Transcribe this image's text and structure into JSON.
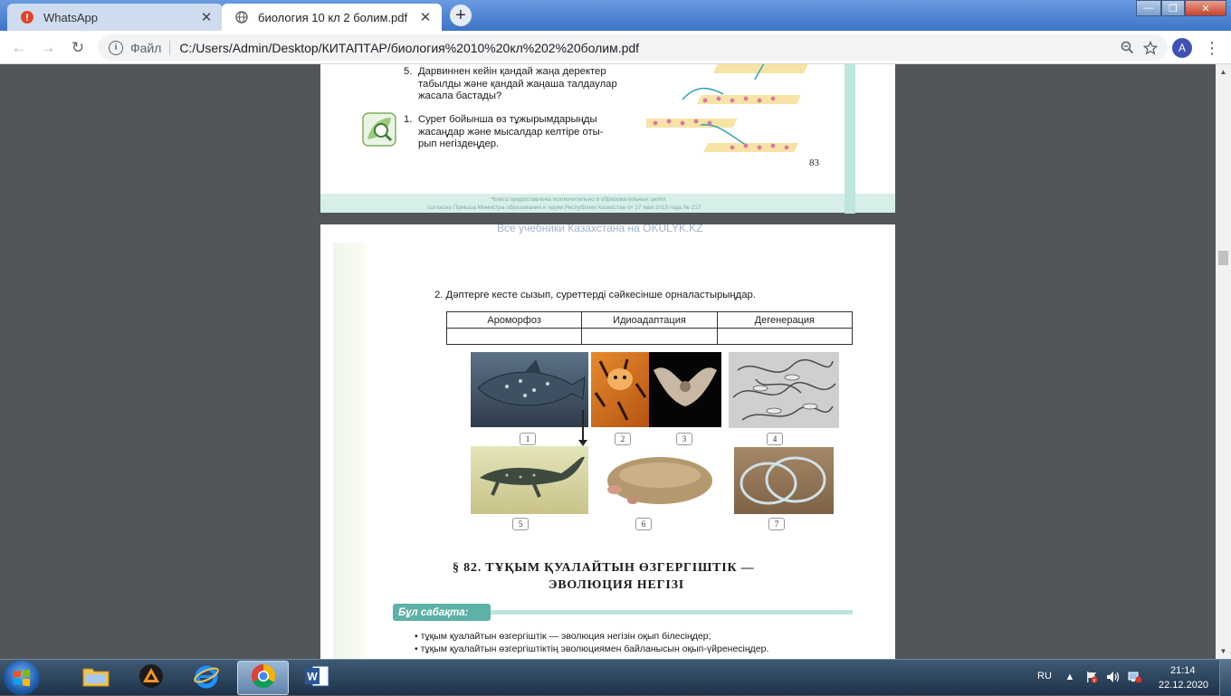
{
  "browser": {
    "tabs": [
      {
        "label": "WhatsApp",
        "icon": "alert-icon",
        "active": false
      },
      {
        "label": "биология 10 кл 2 болим.pdf",
        "icon": "globe-icon",
        "active": true
      }
    ],
    "new_tab_symbol": "+",
    "window_controls": {
      "minimize": "—",
      "maximize": "❐",
      "close": "✕"
    },
    "nav": {
      "back": "←",
      "forward": "→",
      "reload": "↻"
    },
    "address": {
      "info_symbol": "i",
      "scheme_label": "Файл",
      "url": "C:/Users/Admin/Desktop/КИТАПТАР/биология%2010%20кл%202%20болим.pdf"
    },
    "profile_initial": "A",
    "menu_symbol": "⋮"
  },
  "pdf": {
    "page_83": {
      "q5_num": "5.",
      "q5_lines": [
        "Дарвиннен кейін қандай жаңа деректер",
        "табылды және қандай жаңаша талдаулар",
        "жасала бастады?"
      ],
      "q1_num": "1.",
      "q1_lines": [
        "Сурет бойынша өз тұжырымдарыңды",
        "жасаңдар және мысалдар келтіре оты-",
        "рып негіздеңдер."
      ],
      "page_number": "83",
      "legal_lines": [
        "*Книга предоставлена исключительно в образовательных целях",
        "согласно Приказа Министра образования и науки Республики Казахстан от 17 мая 2019 года № 217"
      ]
    },
    "page_84": {
      "watermark": "Все учебники Казахстана на OKULYK.KZ",
      "task_text": "2. Дәптерге кесте сызып, суреттерді сәйкесінше орналастырыңдар.",
      "table_headers": [
        "Ароморфоз",
        "Идиоадаптация",
        "Дегенерация"
      ],
      "photo_labels": [
        "1",
        "2",
        "3",
        "4",
        "5",
        "6",
        "7"
      ],
      "section_line1": "§ 82.   ТҰҚЫМ   ҚУАЛАЙТЫН    ӨЗГЕРГІШТІК   —",
      "section_line2": "ЭВОЛЮЦИЯ    НЕГІЗІ",
      "lesson_label": "Бұл сабақта:",
      "bullets": [
        "• тұқым қуалайтын өзгергіштік — эволюция негізін оқып білесіңдер;",
        "• тұқым қуалайтын өзгергіштіктің эволюциямен байланысын оқып-үйренесіңдер."
      ]
    }
  },
  "taskbar": {
    "apps": [
      "file-explorer",
      "avast",
      "internet-explorer",
      "chrome",
      "word"
    ],
    "active_app": "chrome",
    "language": "RU",
    "time": "21:14",
    "date": "22.12.2020"
  },
  "colors": {
    "tabstrip": "#3d74c7",
    "teal_accent": "#5db1a6",
    "viewer_bg": "#525659"
  }
}
